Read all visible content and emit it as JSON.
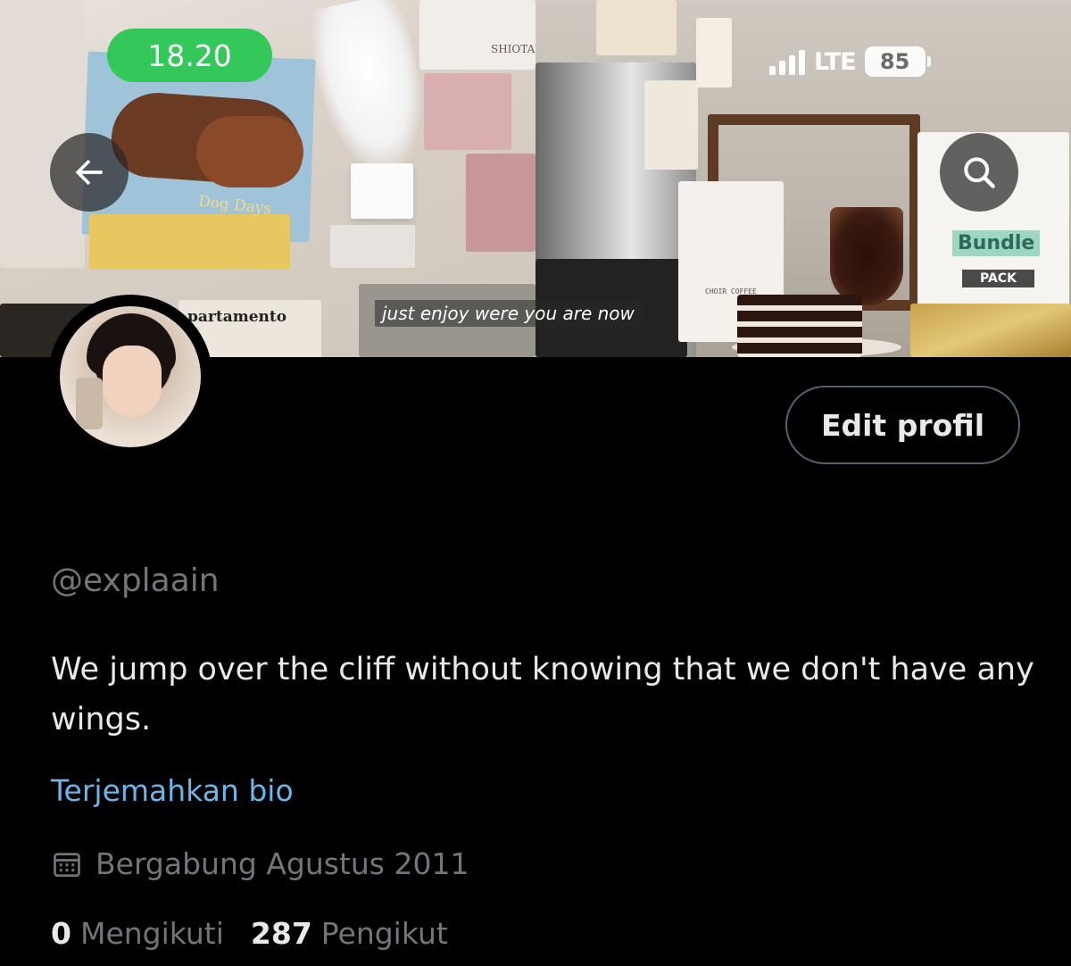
{
  "status_bar": {
    "time": "18.20",
    "network": "LTE",
    "battery": "85"
  },
  "banner": {
    "caption": "just enjoy were you are now",
    "book_title": "Dog Days",
    "magazine_title": "partamento",
    "box_text": "SHIOTA",
    "coffee_bag_text": "CHOIR COFFEE",
    "bundle_label": "Bundle",
    "pack_label": "PACK"
  },
  "nav": {
    "back_icon": "arrow-left-icon",
    "search_icon": "search-icon"
  },
  "profile": {
    "edit_button": "Edit profil",
    "handle": "@explaain",
    "bio": "We jump over the cliff without knowing that we don't have any wings.",
    "translate_link": "Terjemahkan bio",
    "joined": "Bergabung Agustus 2011",
    "following_count": "0",
    "following_label": "Mengikuti",
    "followers_count": "287",
    "followers_label": "Pengikut"
  },
  "colors": {
    "accent_link": "#6ab6e8",
    "time_pill": "#34c759",
    "muted_text": "#71767b"
  }
}
